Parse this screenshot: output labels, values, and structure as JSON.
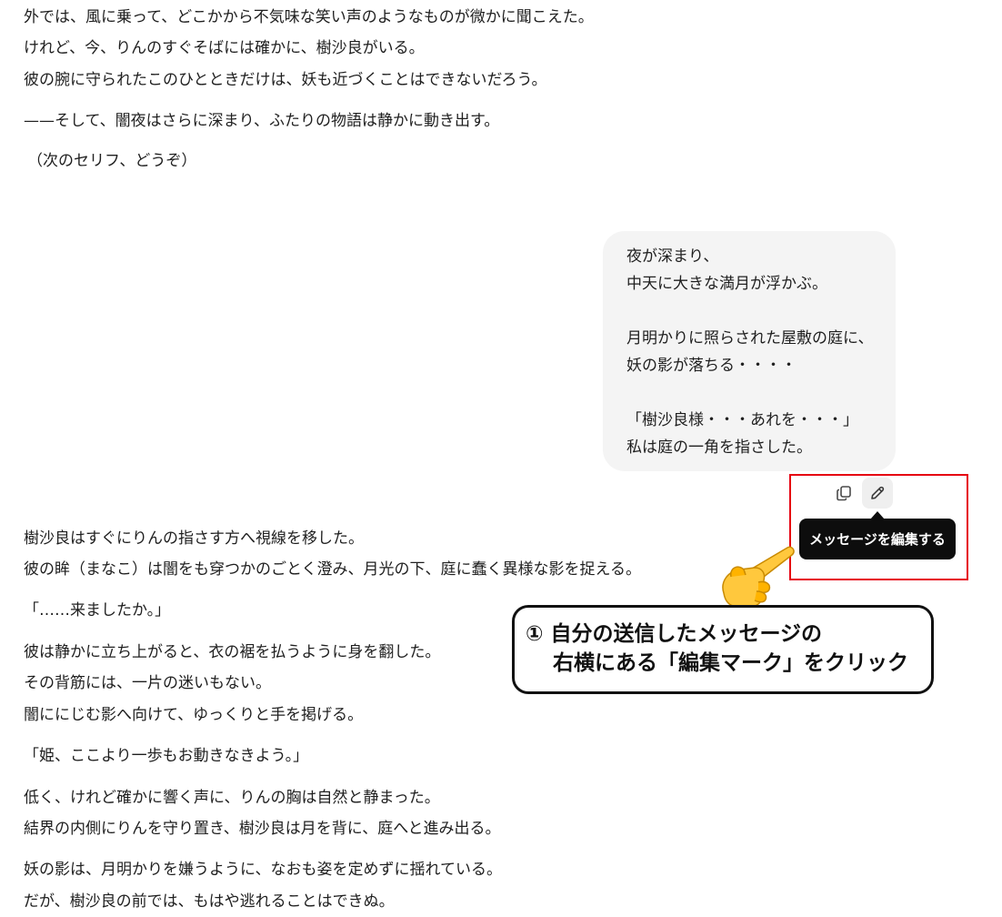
{
  "chat": {
    "assistant_top": {
      "lines": [
        "外では、風に乗って、どこかから不気味な笑い声のようなものが微かに聞こえた。",
        "けれど、今、りんのすぐそばには確かに、樹沙良がいる。",
        "彼の腕に守られたこのひとときだけは、妖も近づくことはできないだろう。",
        "——そして、闇夜はさらに深まり、ふたりの物語は静かに動き出す。",
        "（次のセリフ、どうぞ）"
      ]
    },
    "user_message": {
      "lines": [
        "夜が深まり、",
        "中天に大きな満月が浮かぶ。",
        "",
        "月明かりに照らされた屋敷の庭に、",
        "妖の影が落ちる・・・・",
        "",
        "「樹沙良様・・・あれを・・・」",
        "私は庭の一角を指さした。"
      ]
    },
    "message_actions": {
      "copy_icon": "copy-icon",
      "edit_icon": "pencil-icon",
      "tooltip": "メッセージを編集する"
    },
    "assistant_bottom": {
      "lines": [
        "樹沙良はすぐにりんの指さす方へ視線を移した。",
        "彼の眸（まなこ）は闇をも穿つかのごとく澄み、月光の下、庭に蠢く異様な影を捉える。",
        "「……来ましたか。」",
        "彼は静かに立ち上がると、衣の裾を払うように身を翻した。",
        "その背筋には、一片の迷いもない。",
        "闇ににじむ影へ向けて、ゆっくりと手を掲げる。",
        "「姫、ここより一歩もお動きなきよう。」",
        "低く、けれど確かに響く声に、りんの胸は自然と静まった。",
        "結界の内側にりんを守り置き、樹沙良は月を背に、庭へと進み出る。",
        "妖の影は、月明かりを嫌うように、なおも姿を定めずに揺れている。",
        "だが、樹沙良の前では、もはや逃れることはできぬ。"
      ]
    }
  },
  "annotation": {
    "callout_line1": "① 自分の送信したメッセージの",
    "callout_line2": "右横にある「編集マーク」をクリック",
    "highlight_color": "#e60012",
    "pointer_icon": "pointing-hand-icon"
  }
}
